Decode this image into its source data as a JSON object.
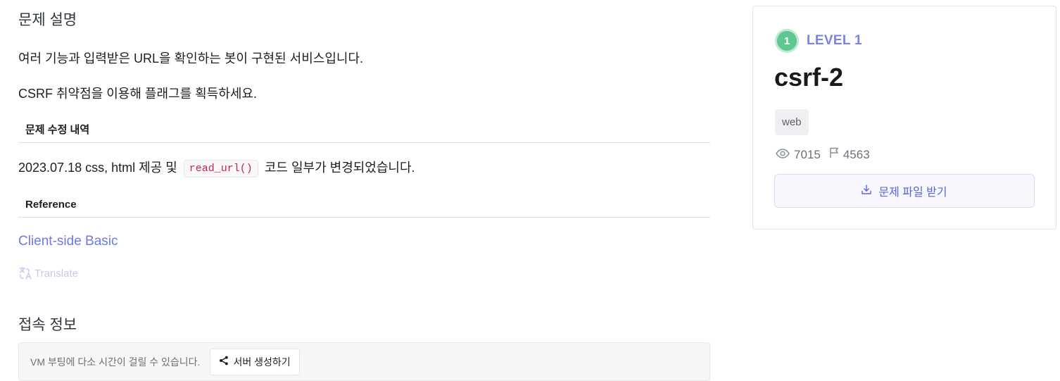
{
  "description": {
    "heading": "문제 설명",
    "line1": "여러 기능과 입력받은 URL을 확인하는 봇이 구현된 서비스입니다.",
    "line2": "CSRF 취약점을 이용해 플래그를 획득하세요."
  },
  "changelog": {
    "heading": "문제 수정 내역",
    "text_before": "2023.07.18 css, html 제공 및",
    "code": "read_url()",
    "text_after": "코드 일부가 변경되었습니다."
  },
  "reference": {
    "heading": "Reference",
    "link_label": "Client-side Basic",
    "translate_label": "Translate"
  },
  "connection": {
    "heading": "접속 정보",
    "note": "VM 부팅에 다소 시간이 걸릴 수 있습니다.",
    "create_button": "서버 생성하기"
  },
  "challenge": {
    "level_number": "1",
    "level_label": "LEVEL 1",
    "title": "csrf-2",
    "tag": "web",
    "views": "7015",
    "solves": "4563",
    "download_button": "문제 파일 받기"
  },
  "colors": {
    "accent": "#6f78e8",
    "level_badge": "#5fc791",
    "code_text": "#c7254e"
  },
  "icons": [
    "translate-icon",
    "share-icon",
    "eye-icon",
    "flag-icon",
    "download-icon"
  ]
}
